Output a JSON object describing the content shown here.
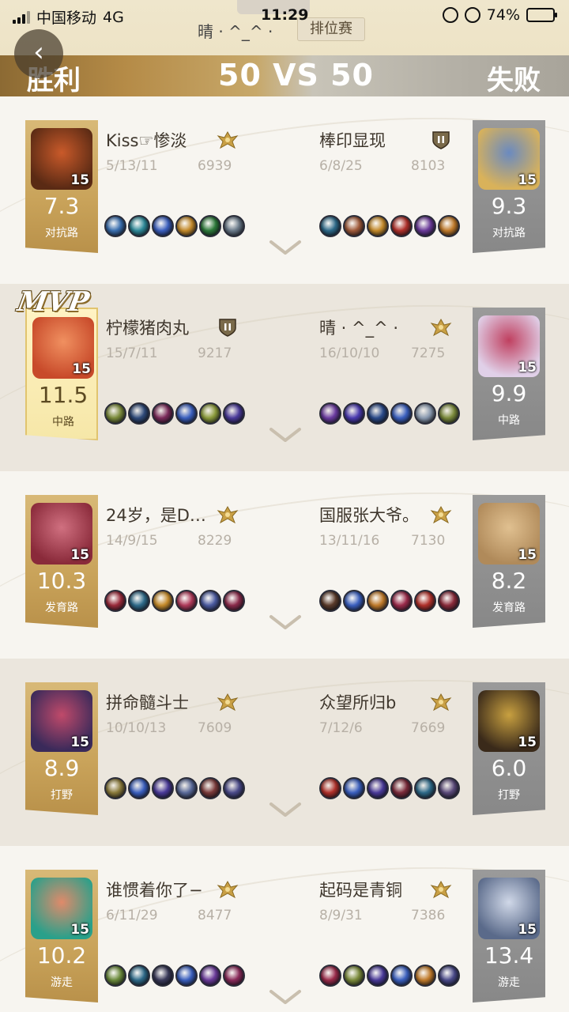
{
  "status_bar": {
    "carrier": "中国移动",
    "network": "4G",
    "time": "11:29",
    "battery_pct": "74%",
    "battery_level": 0.74
  },
  "header": {
    "player_name": "晴 · ^_^ ·",
    "mode": "排位赛",
    "win_label": "胜利",
    "lose_label": "失败",
    "score": "50 VS 50"
  },
  "mvp_label": "MVP",
  "colors": {
    "win_gold": "#c9a35a",
    "lose_gray": "#8f8f8f",
    "rank_gold": "#c9a045",
    "mvp_card": "#f6e7a8"
  },
  "rows": [
    {
      "left": {
        "name": "Kiss☞惨淡",
        "kda": "5/13/11",
        "gold": "6939",
        "level": "15",
        "score": "7.3",
        "role": "对抗路",
        "rank": "gold-wings",
        "hero_colors": [
          "#5a2a14",
          "#c95a2a"
        ],
        "items": [
          "#3a6fb0",
          "#2e8a9a",
          "#3b5fbf",
          "#c48a2a",
          "#2d7a3a",
          "#6a7a8a"
        ]
      },
      "right": {
        "name": "棒印显现",
        "kda": "6/8/25",
        "gold": "8103",
        "level": "15",
        "score": "9.3",
        "role": "对抗路",
        "rank": "shield-ii",
        "hero_colors": [
          "#d9b25a",
          "#6a8ac0"
        ],
        "items": [
          "#2e6a8a",
          "#a05a3a",
          "#c48a2a",
          "#b0302a",
          "#6a3a9a",
          "#c07a2a"
        ]
      }
    },
    {
      "left": {
        "name": "柠檬猪肉丸",
        "kda": "15/7/11",
        "gold": "9217",
        "level": "15",
        "score": "11.5",
        "role": "中路",
        "rank": "shield-ii",
        "mvp": true,
        "hero_colors": [
          "#c84a2a",
          "#f09060"
        ],
        "items": [
          "#7a8a3a",
          "#2e4a7a",
          "#7a2a5a",
          "#3a5fbf",
          "#8a9a3a",
          "#4a3a9a"
        ]
      },
      "right": {
        "name": "晴 · ^_^ ·",
        "kda": "16/10/10",
        "gold": "7275",
        "level": "15",
        "score": "9.9",
        "role": "中路",
        "rank": "gold-wings",
        "hero_colors": [
          "#e0d0e8",
          "#c04060"
        ],
        "items": [
          "#6a3aa0",
          "#4a3ab0",
          "#2a4a8a",
          "#3a5fbf",
          "#8a9ab0",
          "#7a8a3a"
        ]
      }
    },
    {
      "left": {
        "name": "24岁，是D…",
        "kda": "14/9/15",
        "gold": "8229",
        "level": "15",
        "score": "10.3",
        "role": "发育路",
        "rank": "gold-wings",
        "hero_colors": [
          "#8a2a3a",
          "#d07080"
        ],
        "items": [
          "#9a2a3a",
          "#2e6a8a",
          "#c48a2a",
          "#b03a5a",
          "#4a5aa0",
          "#8a2a4a"
        ]
      },
      "right": {
        "name": "国服张大爷。",
        "kda": "13/11/16",
        "gold": "7130",
        "level": "15",
        "score": "8.2",
        "role": "发育路",
        "rank": "gold-wings",
        "hero_colors": [
          "#b08a5a",
          "#e0c090"
        ],
        "items": [
          "#5a3a2a",
          "#3a5fbf",
          "#c07a2a",
          "#9a2a4a",
          "#b0302a",
          "#8a2a3a"
        ]
      }
    },
    {
      "left": {
        "name": "拼命髓斗士",
        "kda": "10/10/13",
        "gold": "7609",
        "level": "15",
        "score": "8.9",
        "role": "打野",
        "rank": "gold-wings",
        "hero_colors": [
          "#3a2a5a",
          "#c04a6a"
        ],
        "items": [
          "#8a7a3a",
          "#3a5fbf",
          "#4a3a9a",
          "#5a6a9a",
          "#7a3a3a",
          "#4a4a8a"
        ]
      },
      "right": {
        "name": "众望所归b",
        "kda": "7/12/6",
        "gold": "7669",
        "level": "15",
        "score": "6.0",
        "role": "打野",
        "rank": "gold-wings",
        "hero_colors": [
          "#3a2a1a",
          "#c8a040"
        ],
        "items": [
          "#b0302a",
          "#3a5fbf",
          "#4a3a9a",
          "#7a2a3a",
          "#2e6a8a",
          "#5a4a7a"
        ]
      }
    },
    {
      "left": {
        "name": "谁惯着你了−",
        "kda": "6/11/29",
        "gold": "8477",
        "level": "15",
        "score": "10.2",
        "role": "游走",
        "rank": "gold-wings",
        "hero_colors": [
          "#2aa08a",
          "#e08a6a"
        ],
        "items": [
          "#6a8a3a",
          "#2e6a8a",
          "#3a3a5a",
          "#3a5fbf",
          "#6a3a9a",
          "#8a2a5a"
        ]
      },
      "right": {
        "name": "起码是青铜",
        "kda": "8/9/31",
        "gold": "7386",
        "level": "15",
        "score": "13.4",
        "role": "游走",
        "rank": "gold-wings",
        "hero_colors": [
          "#5a6a8a",
          "#d0d8e8"
        ],
        "items": [
          "#9a2a4a",
          "#7a8a3a",
          "#4a3a9a",
          "#3a5fbf",
          "#c07a2a",
          "#4a4a8a"
        ]
      }
    }
  ]
}
